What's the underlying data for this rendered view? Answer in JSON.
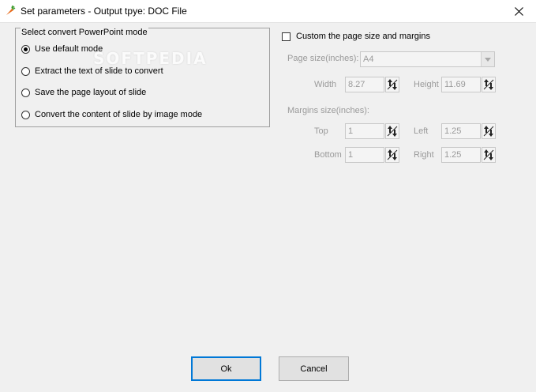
{
  "window": {
    "title": "Set parameters - Output tpye: DOC File",
    "app_icon": "carrot-icon",
    "close_icon": "close-icon"
  },
  "mode_group": {
    "legend": "Select convert PowerPoint mode",
    "options": [
      {
        "label": "Use default mode",
        "checked": true
      },
      {
        "label": "Extract the text of slide to convert",
        "checked": false
      },
      {
        "label": "Save the page layout of slide",
        "checked": false
      },
      {
        "label": "Convert the content of slide by image mode",
        "checked": false
      }
    ],
    "watermark": "SOFTPEDIA"
  },
  "custom": {
    "checkbox_label": "Custom the page size and margins",
    "checked": false,
    "page_size_label": "Page size(inches):",
    "page_size_value": "A4",
    "width_label": "Width",
    "width_value": "8.27",
    "height_label": "Height",
    "height_value": "11.69",
    "margins_label": "Margins size(inches):",
    "top_label": "Top",
    "top_value": "1",
    "left_label": "Left",
    "left_value": "1.25",
    "bottom_label": "Bottom",
    "bottom_value": "1",
    "right_label": "Right",
    "right_value": "1.25"
  },
  "buttons": {
    "ok": "Ok",
    "cancel": "Cancel"
  },
  "colors": {
    "window_bg": "#f0f0f0",
    "disabled_text": "#9a9a9a",
    "default_button_border": "#0078d7"
  }
}
